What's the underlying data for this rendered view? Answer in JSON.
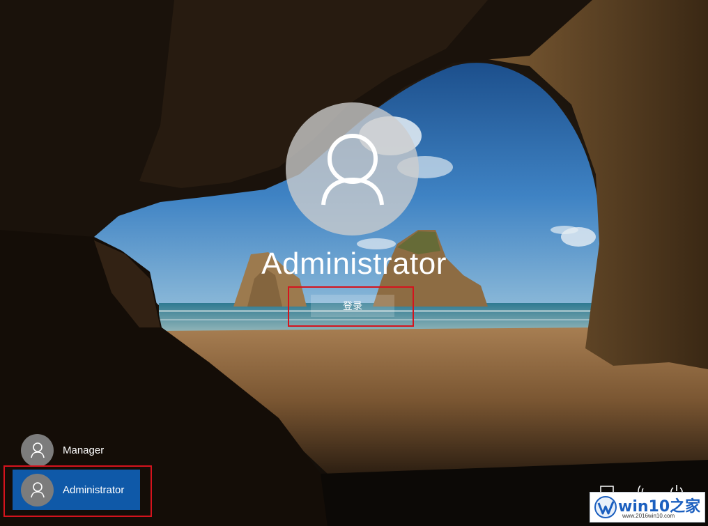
{
  "login": {
    "user_name": "Administrator",
    "signin_label": "登录"
  },
  "user_list": [
    {
      "name": "Manager",
      "active": false
    },
    {
      "name": "Administrator",
      "active": true
    }
  ],
  "watermark": {
    "text": "win10之家",
    "url": "www.2016win10.com"
  },
  "colors": {
    "active_user_bg": "#0f59a8",
    "highlight": "#d5131d"
  },
  "icons": [
    "user-icon",
    "network-icon",
    "ease-of-access-icon",
    "power-icon"
  ]
}
